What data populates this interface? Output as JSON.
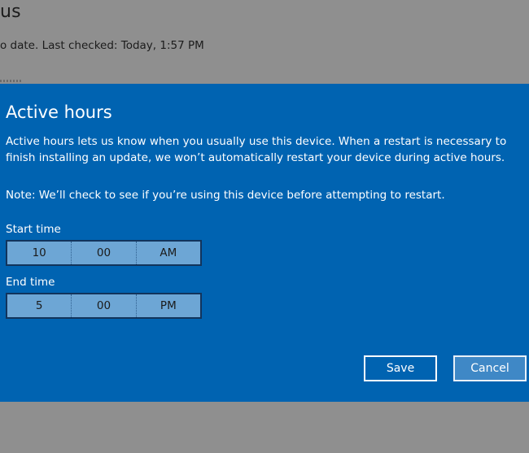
{
  "background": {
    "title": "us",
    "status": "o date. Last checked: Today, 1:57 PM"
  },
  "dialog": {
    "title": "Active hours",
    "description": "Active hours lets us know when you usually use this device. When a restart is necessary to finish installing an update, we won’t automatically restart your device during active hours.",
    "note": "Note: We’ll check to see if you’re using this device before attempting to restart.",
    "start_time": {
      "label": "Start time",
      "hour": "10",
      "minute": "00",
      "period": "AM"
    },
    "end_time": {
      "label": "End time",
      "hour": "5",
      "minute": "00",
      "period": "PM"
    },
    "save_label": "Save",
    "cancel_label": "Cancel"
  },
  "colors": {
    "dialog_background": "#0063b1",
    "picker_fill": "#6da6d5",
    "overlay": "#8e8e8e"
  }
}
